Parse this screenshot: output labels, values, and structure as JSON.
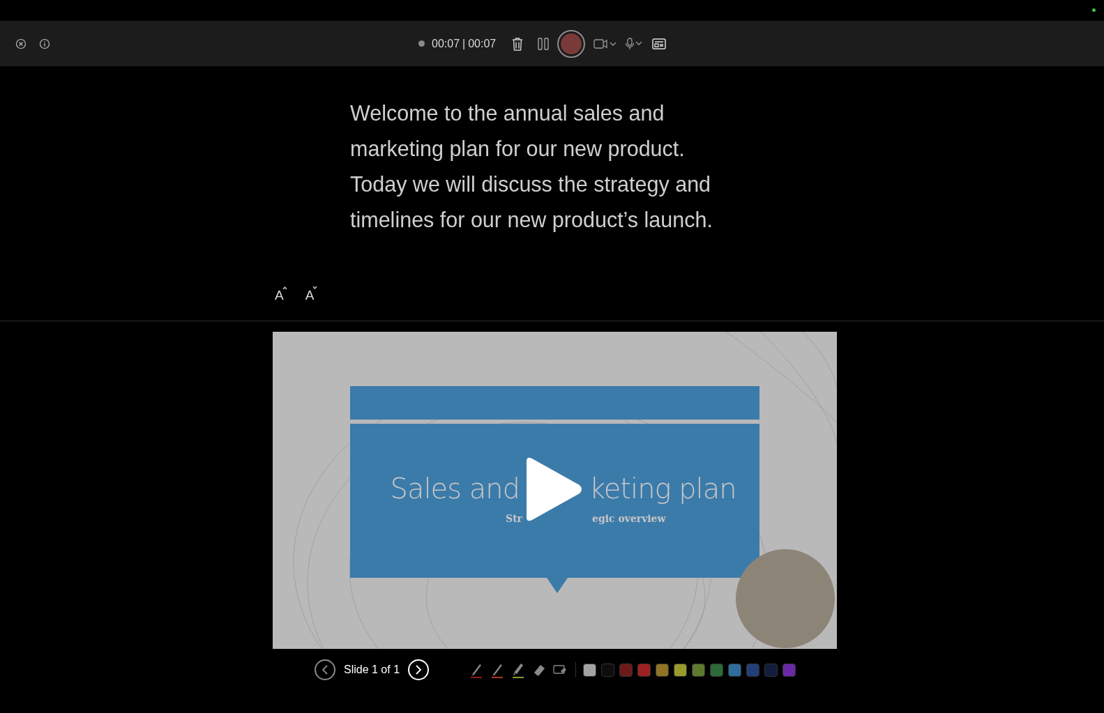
{
  "toolbar": {
    "elapsed": "00:07",
    "total": "00:07",
    "separator": "|"
  },
  "script": {
    "text": "Welcome to the annual sales and marketing plan for our new product. Today we will discuss the strategy and timelines for our new product’s launch."
  },
  "slide": {
    "title_before": "Sales and",
    "title_after": "keting plan",
    "subtitle_before": "Str",
    "subtitle_after": "egic overview"
  },
  "navigation": {
    "label": "Slide 1 of 1"
  },
  "font_buttons": [
    {
      "kind": "increase",
      "label": "A"
    },
    {
      "kind": "decrease",
      "label": "A"
    }
  ],
  "pens": [
    {
      "kind": "pen",
      "color": "#8a1a1a",
      "selected": false
    },
    {
      "kind": "pen",
      "color": "#b03020",
      "selected": false
    },
    {
      "kind": "highlighter",
      "color": "#8a9a30",
      "selected": false
    },
    {
      "kind": "eraser",
      "selected": false
    },
    {
      "kind": "lasso",
      "selected": false
    }
  ],
  "colors": [
    {
      "color": "#a3a3a3",
      "selected": false
    },
    {
      "color": "#0d0d0d",
      "selected": false
    },
    {
      "color": "#6e1a1a",
      "selected": false
    },
    {
      "color": "#9c2121",
      "selected": false
    },
    {
      "color": "#8f7424",
      "selected": false
    },
    {
      "color": "#9a9a2c",
      "selected": false
    },
    {
      "color": "#5f7a2e",
      "selected": false
    },
    {
      "color": "#2d6a3a",
      "selected": false
    },
    {
      "color": "#2f6d9c",
      "selected": false
    },
    {
      "color": "#223f78",
      "selected": false
    },
    {
      "color": "#121c3c",
      "selected": false
    },
    {
      "color": "#6a2aa6",
      "selected": false
    }
  ]
}
